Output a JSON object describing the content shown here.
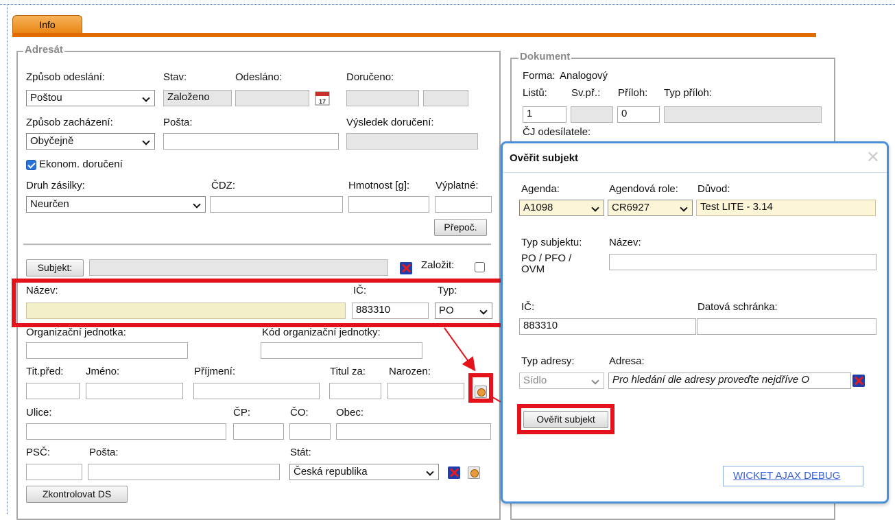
{
  "tab": {
    "label": "Info"
  },
  "adresat": {
    "legend": "Adresát",
    "zpusob_odeslani": {
      "label": "Způsob odeslání:",
      "value": "Poštou"
    },
    "stav": {
      "label": "Stav:",
      "value": "Založeno"
    },
    "odeslano": {
      "label": "Odesláno:",
      "value": ""
    },
    "doruceno": {
      "label": "Doručeno:",
      "value": ""
    },
    "zpusob_zachazeni": {
      "label": "Způsob zacházení:",
      "value": "Obyčejně"
    },
    "posta": {
      "label": "Pošta:",
      "value": ""
    },
    "vysledek": {
      "label": "Výsledek doručení:",
      "value": ""
    },
    "ekonom": {
      "label": "Ekonom. doručení",
      "checked": true
    },
    "druh_zasilky": {
      "label": "Druh zásilky:",
      "value": "Neurčen"
    },
    "cdz": {
      "label": "ČDZ:",
      "value": ""
    },
    "hmotnost": {
      "label": "Hmotnost [g]:",
      "value": ""
    },
    "vyplatne": {
      "label": "Výplatné:",
      "value": ""
    },
    "prepoc_button": "Přepoč.",
    "subjekt_button": "Subjekt:",
    "zalozit": {
      "label": "Založit:",
      "checked": false
    },
    "nazev": {
      "label": "Název:",
      "value": ""
    },
    "ic": {
      "label": "IČ:",
      "value": "883310"
    },
    "typ": {
      "label": "Typ:",
      "value": "PO"
    },
    "org_jednotka": {
      "label": "Organizační jednotka:",
      "value": ""
    },
    "kod_org": {
      "label": "Kód organizační jednotky:",
      "value": ""
    },
    "tit_pred": {
      "label": "Tit.před:"
    },
    "jmeno": {
      "label": "Jméno:"
    },
    "prijmeni": {
      "label": "Příjmení:"
    },
    "titul_za": {
      "label": "Titul za:"
    },
    "narozen": {
      "label": "Narozen:"
    },
    "ulice": {
      "label": "Ulice:"
    },
    "cp": {
      "label": "ČP:"
    },
    "co": {
      "label": "ČO:"
    },
    "obec": {
      "label": "Obec:"
    },
    "psc": {
      "label": "PSČ:"
    },
    "posta2": {
      "label": "Pošta:"
    },
    "stat": {
      "label": "Stát:",
      "value": "Česká republika"
    },
    "zkontrolovat_button": "Zkontrolovat DS"
  },
  "dokument": {
    "legend": "Dokument",
    "forma": {
      "label": "Forma:",
      "value": "Analogový"
    },
    "listu": {
      "label": "Listů:",
      "value": "1"
    },
    "sv_pr": {
      "label": "Sv.př.:",
      "value": ""
    },
    "priloh": {
      "label": "Příloh:",
      "value": "0"
    },
    "typ_priloh": {
      "label": "Typ příloh:",
      "value": ""
    },
    "cj_odesilatele": {
      "label": "ČJ odesílatele:"
    }
  },
  "modal": {
    "title": "Ověřit subjekt",
    "close": "✕",
    "agenda": {
      "label": "Agenda:",
      "value": "A1098"
    },
    "agendova_role": {
      "label": "Agendová role:",
      "value": "CR6927"
    },
    "duvod": {
      "label": "Důvod:",
      "value": "Test LITE - 3.14"
    },
    "typ_subjektu": {
      "label": "Typ subjektu:",
      "value": "PO / PFO / OVM"
    },
    "nazev": {
      "label": "Název:",
      "value": ""
    },
    "ic": {
      "label": "IČ:",
      "value": "883310"
    },
    "datova_schranka": {
      "label": "Datová schránka:",
      "value": ""
    },
    "typ_adresy": {
      "label": "Typ adresy:",
      "value": "Sídlo"
    },
    "adresa": {
      "label": "Adresa:",
      "value": "Pro hledání dle adresy proveďte nejdříve O"
    },
    "overit_button": "Ověřit subjekt",
    "debug_link": "WICKET AJAX DEBUG"
  },
  "colors": {
    "tab_accent": "#e06c00",
    "highlight_red": "#e3121b",
    "modal_border": "#4c8fd9"
  }
}
